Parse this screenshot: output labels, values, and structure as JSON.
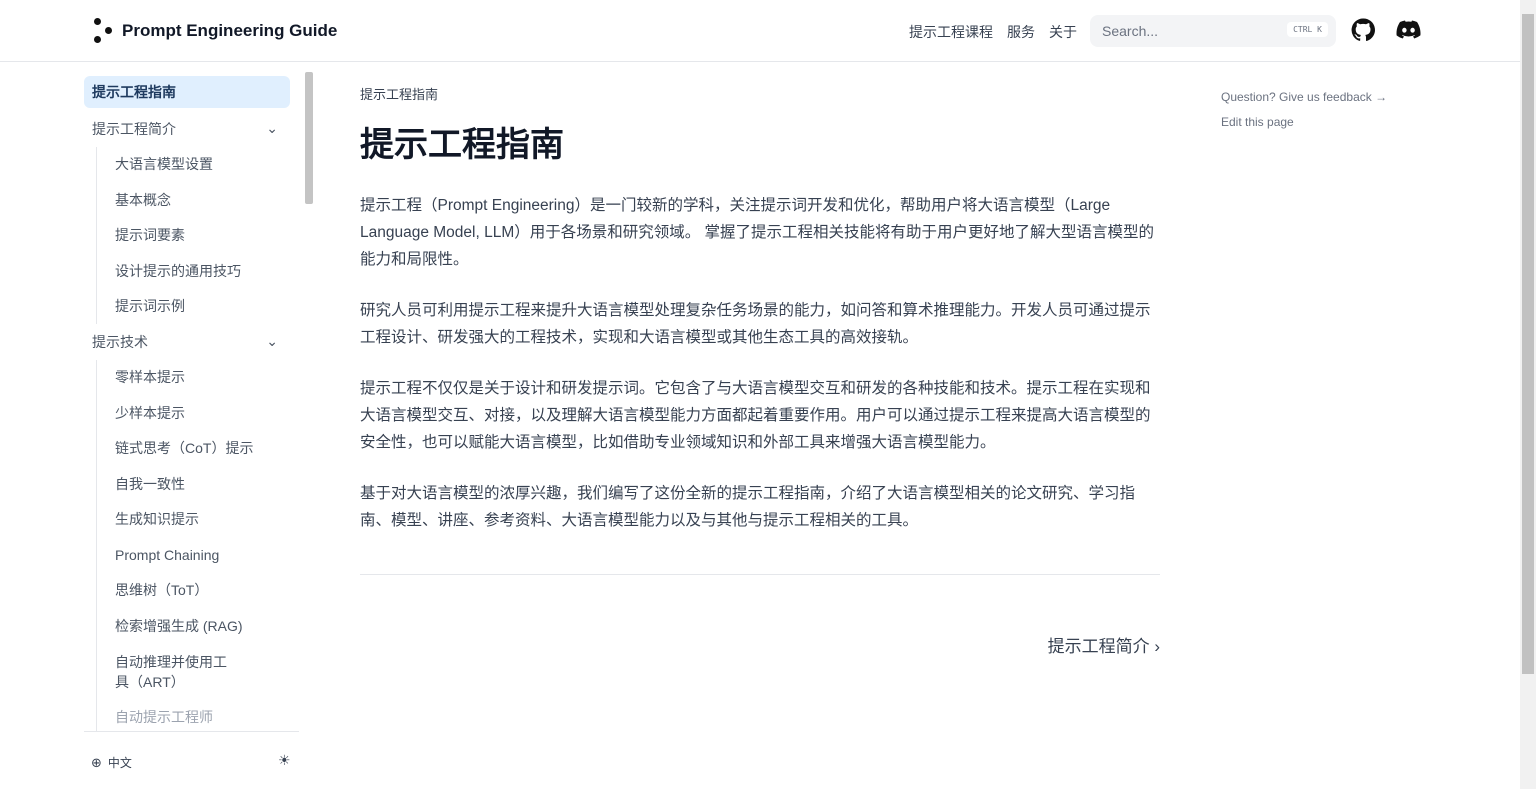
{
  "brand": "Prompt Engineering Guide",
  "nav": {
    "links": [
      "提示工程课程",
      "服务",
      "关于"
    ],
    "search_placeholder": "Search...",
    "shortcut": "CTRL K"
  },
  "sidebar": {
    "items": [
      {
        "label": "提示工程指南",
        "active": true
      },
      {
        "label": "提示工程简介",
        "children": [
          "大语言模型设置",
          "基本概念",
          "提示词要素",
          "设计提示的通用技巧",
          "提示词示例"
        ]
      },
      {
        "label": "提示技术",
        "children": [
          "零样本提示",
          "少样本提示",
          "链式思考（CoT）提示",
          "自我一致性",
          "生成知识提示",
          "Prompt Chaining",
          "思维树（ToT）",
          "检索增强生成 (RAG)",
          "自动推理并使用工具（ART）",
          "自动提示工程师"
        ]
      }
    ],
    "language": "中文"
  },
  "main": {
    "breadcrumb": "提示工程指南",
    "title": "提示工程指南",
    "paragraphs": [
      "提示工程（Prompt Engineering）是一门较新的学科，关注提示词开发和优化，帮助用户将大语言模型（Large Language Model, LLM）用于各场景和研究领域。 掌握了提示工程相关技能将有助于用户更好地了解大型语言模型的能力和局限性。",
      "研究人员可利用提示工程来提升大语言模型处理复杂任务场景的能力，如问答和算术推理能力。开发人员可通过提示工程设计、研发强大的工程技术，实现和大语言模型或其他生态工具的高效接轨。",
      "提示工程不仅仅是关于设计和研发提示词。它包含了与大语言模型交互和研发的各种技能和技术。提示工程在实现和大语言模型交互、对接，以及理解大语言模型能力方面都起着重要作用。用户可以通过提示工程来提高大语言模型的安全性，也可以赋能大语言模型，比如借助专业领域知识和外部工具来增强大语言模型能力。",
      "基于对大语言模型的浓厚兴趣，我们编写了这份全新的提示工程指南，介绍了大语言模型相关的论文研究、学习指南、模型、讲座、参考资料、大语言模型能力以及与其他与提示工程相关的工具。"
    ],
    "next": "提示工程简介"
  },
  "toc": {
    "feedback": "Question? Give us feedback →",
    "edit": "Edit this page"
  }
}
